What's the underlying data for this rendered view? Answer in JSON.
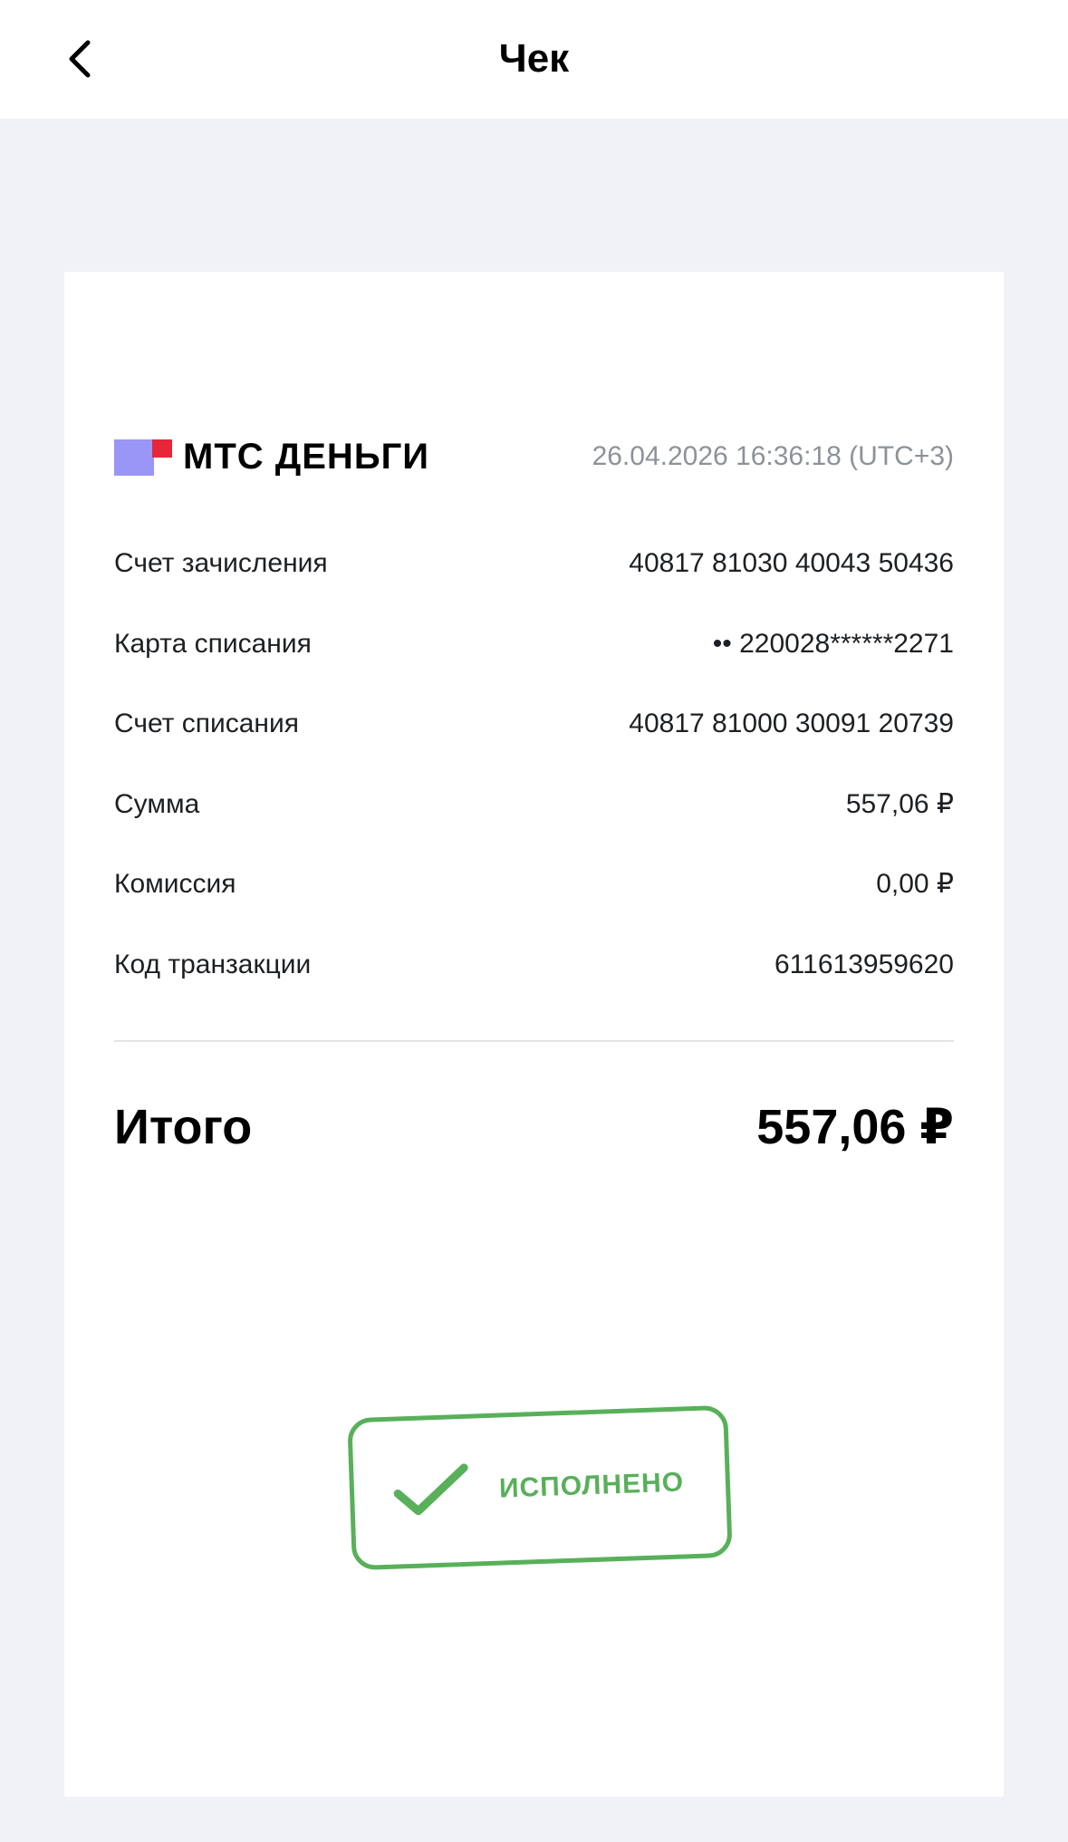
{
  "header": {
    "title": "Чек",
    "back_icon": "chevron-left-icon"
  },
  "receipt": {
    "brand": {
      "name": "МТС ДЕНЬГИ",
      "colors": {
        "violet": "#9a96f5",
        "red": "#e8263a"
      }
    },
    "datetime": "26.04.2026 16:36:18 (UTC+3)",
    "rows": [
      {
        "label": "Счет зачисления",
        "value": "40817 81030 40043 50436"
      },
      {
        "label": "Карта списания",
        "value": "•• 220028******2271"
      },
      {
        "label": "Счет списания",
        "value": "40817 81000 30091 20739"
      },
      {
        "label": "Сумма",
        "value": "557,06 ₽"
      },
      {
        "label": "Комиссия",
        "value": "0,00 ₽"
      },
      {
        "label": "Код транзакции",
        "value": "611613959620"
      }
    ],
    "total": {
      "label": "Итого",
      "value": "557,06 ₽"
    },
    "stamp": {
      "text": "ИСПОЛНЕНО",
      "icon": "checkmark-icon",
      "color": "#58b05a"
    }
  }
}
